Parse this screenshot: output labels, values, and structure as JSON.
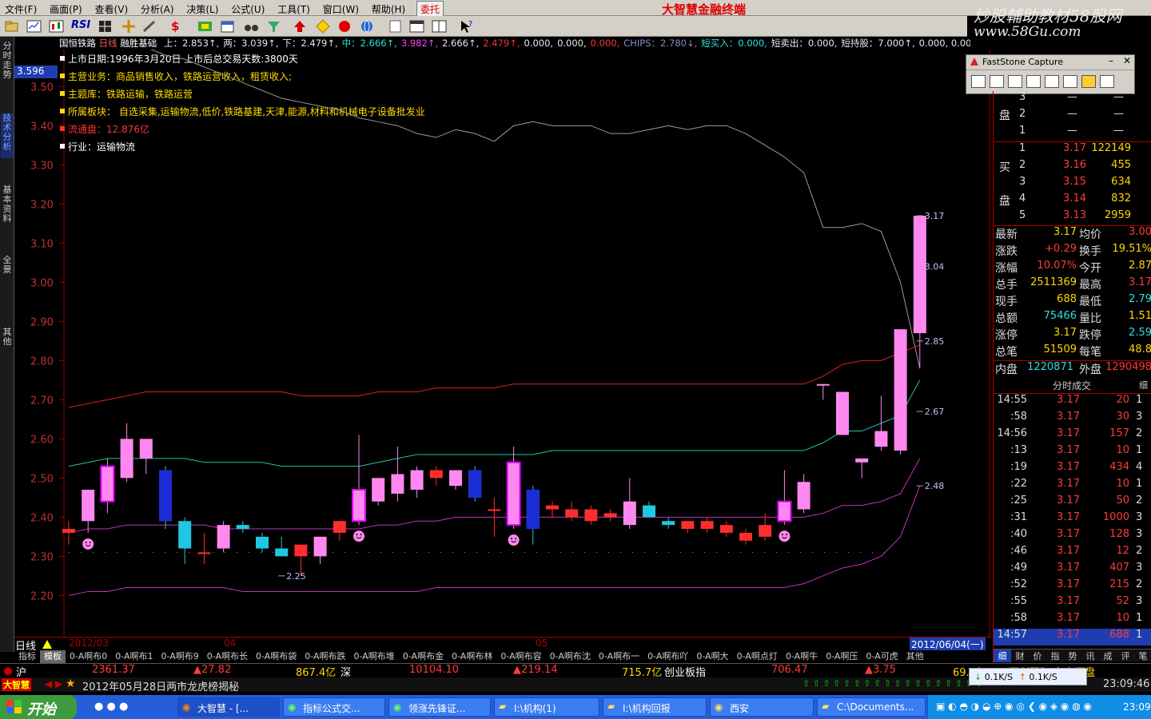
{
  "menu": [
    "文件(F)",
    "画面(P)",
    "查看(V)",
    "分析(A)",
    "决策(L)",
    "公式(U)",
    "工具(T)",
    "窗口(W)",
    "帮助(H)"
  ],
  "entrust_label": "委托",
  "app_title": "大智慧金融终端",
  "watermark": {
    "line1": "炒股輔助教材58股网",
    "line2": "www.58Gu.com"
  },
  "toolbar_rsi": "RSI",
  "left_tabs": [
    "分时走势",
    "技术分析",
    "基本资料",
    "全景",
    "其他"
  ],
  "stock_header": {
    "name": "国恒铁路",
    "period": "日线",
    "indicator": "融胜基础",
    "items": [
      {
        "t": "上：2.853↑,",
        "c": "#e8e8e8"
      },
      {
        "t": "两：3.039↑,",
        "c": "#e8e8e8"
      },
      {
        "t": "下：2.479↑,",
        "c": "#e8e8e8"
      },
      {
        "t": "中：2.666↑,",
        "c": "#2ee0e0"
      },
      {
        "t": "3.982↑,",
        "c": "#ff44ff"
      },
      {
        "t": "2.666↑,",
        "c": "#e8e8e8"
      },
      {
        "t": "2.479↑,",
        "c": "#ff3333"
      },
      {
        "t": "0.000,",
        "c": "#e8e8e8"
      },
      {
        "t": "0.000,",
        "c": "#e8e8e8"
      },
      {
        "t": "0.000,",
        "c": "#ff3333"
      },
      {
        "t": "CHIPS：2.780↓,",
        "c": "#8888cc"
      },
      {
        "t": "短买入：0.000,",
        "c": "#2ee0e0"
      },
      {
        "t": "短卖出：0.000,",
        "c": "#e8e8e8"
      },
      {
        "t": "短持股：7.000↑,",
        "c": "#e8e8e8"
      },
      {
        "t": "0.000, 0.000, 0.000,",
        "c": "#e8e8e8"
      }
    ]
  },
  "f10": [
    {
      "text": "上市日期:1996年3月20日  上市后总交易天数:3800天",
      "color": "#ffffff"
    },
    {
      "text": "主营业务：商品销售收入，铁路运营收入，租赁收入;",
      "color": "#ffdd00"
    },
    {
      "text": "主题库：铁路运输，铁路运营",
      "color": "#ffdd00"
    },
    {
      "text": "所属板块：  自选采集,运输物流,低价,铁路基建,天津,能源,材料和机械电子设备批发业",
      "color": "#ffdd00"
    },
    {
      "text": "流通盘：12.876亿",
      "color": "#ff3333"
    },
    {
      "text": "行业：运输物流",
      "color": "#ffffff"
    }
  ],
  "current_price_tag": "3.596",
  "chart_data": {
    "type": "candlestick",
    "ylim": [
      2.18,
      3.62
    ],
    "yticks": [
      "3.50",
      "3.40",
      "3.30",
      "3.20",
      "3.10",
      "3.00",
      "2.90",
      "2.80",
      "2.70",
      "2.60",
      "2.50",
      "2.40",
      "2.30",
      "2.20"
    ],
    "x_labels": [
      "2012/03",
      "04",
      "05"
    ],
    "end_date": "2012/06/04(一)",
    "period_label": "日线",
    "candles": [
      {
        "o": 2.36,
        "h": 2.39,
        "l": 2.33,
        "c": 2.37
      },
      {
        "o": 2.39,
        "h": 2.47,
        "l": 2.36,
        "c": 2.47
      },
      {
        "o": 2.44,
        "h": 2.55,
        "l": 2.41,
        "c": 2.53
      },
      {
        "o": 2.5,
        "h": 2.64,
        "l": 2.49,
        "c": 2.6
      },
      {
        "o": 2.55,
        "h": 2.6,
        "l": 2.51,
        "c": 2.6
      },
      {
        "o": 2.52,
        "h": 2.53,
        "l": 2.37,
        "c": 2.39
      },
      {
        "o": 2.39,
        "h": 2.4,
        "l": 2.28,
        "c": 2.32
      },
      {
        "o": 2.31,
        "h": 2.36,
        "l": 2.28,
        "c": 2.31
      },
      {
        "o": 2.32,
        "h": 2.39,
        "l": 2.31,
        "c": 2.38
      },
      {
        "o": 2.38,
        "h": 2.39,
        "l": 2.36,
        "c": 2.37
      },
      {
        "o": 2.35,
        "h": 2.36,
        "l": 2.31,
        "c": 2.32
      },
      {
        "o": 2.32,
        "h": 2.35,
        "l": 2.3,
        "c": 2.3
      },
      {
        "o": 2.3,
        "h": 2.33,
        "l": 2.25,
        "c": 2.33
      },
      {
        "o": 2.3,
        "h": 2.35,
        "l": 2.28,
        "c": 2.35
      },
      {
        "o": 2.36,
        "h": 2.39,
        "l": 2.34,
        "c": 2.39
      },
      {
        "o": 2.39,
        "h": 2.61,
        "l": 2.38,
        "c": 2.47
      },
      {
        "o": 2.44,
        "h": 2.5,
        "l": 2.43,
        "c": 2.5
      },
      {
        "o": 2.46,
        "h": 2.58,
        "l": 2.44,
        "c": 2.51
      },
      {
        "o": 2.47,
        "h": 2.53,
        "l": 2.45,
        "c": 2.52
      },
      {
        "o": 2.5,
        "h": 2.53,
        "l": 2.48,
        "c": 2.52
      },
      {
        "o": 2.48,
        "h": 2.52,
        "l": 2.47,
        "c": 2.52
      },
      {
        "o": 2.52,
        "h": 2.53,
        "l": 2.44,
        "c": 2.45
      },
      {
        "o": 2.42,
        "h": 2.45,
        "l": 2.35,
        "c": 2.42
      },
      {
        "o": 2.38,
        "h": 2.58,
        "l": 2.37,
        "c": 2.54
      },
      {
        "o": 2.47,
        "h": 2.48,
        "l": 2.33,
        "c": 2.37
      },
      {
        "o": 2.42,
        "h": 2.44,
        "l": 2.4,
        "c": 2.43
      },
      {
        "o": 2.4,
        "h": 2.44,
        "l": 2.39,
        "c": 2.42
      },
      {
        "o": 2.39,
        "h": 2.43,
        "l": 2.38,
        "c": 2.42
      },
      {
        "o": 2.4,
        "h": 2.42,
        "l": 2.39,
        "c": 2.41
      },
      {
        "o": 2.38,
        "h": 2.5,
        "l": 2.37,
        "c": 2.44
      },
      {
        "o": 2.43,
        "h": 2.44,
        "l": 2.4,
        "c": 2.4
      },
      {
        "o": 2.39,
        "h": 2.4,
        "l": 2.37,
        "c": 2.38
      },
      {
        "o": 2.37,
        "h": 2.39,
        "l": 2.36,
        "c": 2.39
      },
      {
        "o": 2.37,
        "h": 2.4,
        "l": 2.36,
        "c": 2.39
      },
      {
        "o": 2.36,
        "h": 2.39,
        "l": 2.35,
        "c": 2.38
      },
      {
        "o": 2.34,
        "h": 2.37,
        "l": 2.33,
        "c": 2.36
      },
      {
        "o": 2.35,
        "h": 2.41,
        "l": 2.34,
        "c": 2.38
      },
      {
        "o": 2.39,
        "h": 2.52,
        "l": 2.38,
        "c": 2.44
      },
      {
        "o": 2.42,
        "h": 2.51,
        "l": 2.41,
        "c": 2.49
      },
      {
        "o": 2.74,
        "h": 2.74,
        "l": 2.7,
        "c": 2.74
      },
      {
        "o": 2.61,
        "h": 2.72,
        "l": 2.61,
        "c": 2.72
      },
      {
        "o": 2.54,
        "h": 2.55,
        "l": 2.5,
        "c": 2.55
      },
      {
        "o": 2.58,
        "h": 2.71,
        "l": 2.57,
        "c": 2.62
      },
      {
        "o": 2.57,
        "h": 2.88,
        "l": 2.56,
        "c": 2.88
      },
      {
        "o": 2.87,
        "h": 3.17,
        "l": 2.78,
        "c": 3.17
      }
    ],
    "upper_mid": [
      2.68,
      2.69,
      2.7,
      2.71,
      2.72,
      2.72,
      2.72,
      2.72,
      2.72,
      2.72,
      2.72,
      2.72,
      2.71,
      2.71,
      2.71,
      2.71,
      2.72,
      2.72,
      2.72,
      2.73,
      2.73,
      2.73,
      2.73,
      2.74,
      2.74,
      2.74,
      2.74,
      2.74,
      2.74,
      2.74,
      2.74,
      2.74,
      2.74,
      2.74,
      2.74,
      2.74,
      2.74,
      2.74,
      2.74,
      2.76,
      2.79,
      2.8,
      2.8,
      2.82,
      2.84
    ],
    "mid_cyan": [
      2.53,
      2.54,
      2.55,
      2.55,
      2.55,
      2.55,
      2.55,
      2.54,
      2.54,
      2.54,
      2.54,
      2.53,
      2.53,
      2.53,
      2.53,
      2.53,
      2.54,
      2.55,
      2.56,
      2.56,
      2.56,
      2.56,
      2.56,
      2.56,
      2.56,
      2.57,
      2.57,
      2.57,
      2.57,
      2.57,
      2.57,
      2.57,
      2.57,
      2.57,
      2.57,
      2.57,
      2.57,
      2.57,
      2.57,
      2.59,
      2.62,
      2.62,
      2.64,
      2.66,
      2.75
    ],
    "lower_mid": [
      2.36,
      2.37,
      2.37,
      2.38,
      2.38,
      2.38,
      2.38,
      2.38,
      2.37,
      2.37,
      2.37,
      2.37,
      2.37,
      2.37,
      2.37,
      2.37,
      2.38,
      2.38,
      2.39,
      2.39,
      2.4,
      2.4,
      2.4,
      2.4,
      2.4,
      2.4,
      2.4,
      2.4,
      2.4,
      2.4,
      2.4,
      2.4,
      2.4,
      2.4,
      2.4,
      2.4,
      2.4,
      2.4,
      2.4,
      2.41,
      2.43,
      2.43,
      2.44,
      2.46,
      2.55
    ],
    "lower": [
      2.2,
      2.21,
      2.21,
      2.22,
      2.22,
      2.22,
      2.22,
      2.22,
      2.22,
      2.21,
      2.21,
      2.21,
      2.21,
      2.21,
      2.21,
      2.21,
      2.21,
      2.21,
      2.21,
      2.22,
      2.22,
      2.22,
      2.22,
      2.22,
      2.22,
      2.22,
      2.22,
      2.22,
      2.22,
      2.22,
      2.22,
      2.22,
      2.22,
      2.22,
      2.22,
      2.22,
      2.22,
      2.22,
      2.23,
      2.25,
      2.27,
      2.28,
      2.3,
      2.35,
      2.48
    ],
    "gray_line": [
      3.7,
      3.68,
      3.65,
      3.62,
      3.6,
      3.58,
      3.57,
      3.55,
      3.53,
      3.51,
      3.49,
      3.47,
      3.46,
      3.45,
      3.44,
      3.42,
      3.41,
      3.4,
      3.38,
      3.37,
      3.39,
      3.38,
      3.36,
      3.4,
      3.41,
      3.4,
      3.4,
      3.4,
      3.38,
      3.38,
      3.39,
      3.4,
      3.39,
      3.4,
      3.4,
      3.38,
      3.35,
      3.32,
      3.28,
      3.14,
      3.14,
      3.15,
      3.13,
      3.0,
      2.78
    ],
    "labels": [
      {
        "i": 44,
        "y": 3.17,
        "text": "3.17"
      },
      {
        "i": 44,
        "y": 3.04,
        "text": "3.04"
      },
      {
        "i": 44,
        "y": 2.85,
        "text": "2.85"
      },
      {
        "i": 44,
        "y": 2.67,
        "text": "2.67"
      },
      {
        "i": 44,
        "y": 2.48,
        "text": "2.48"
      },
      {
        "i": 11,
        "y": 2.25,
        "text": "2.25"
      }
    ],
    "smileys": [
      1,
      15,
      23,
      37
    ],
    "markers": [
      5,
      23,
      21,
      24
    ]
  },
  "indicator_tabs": [
    "指标",
    "模板",
    "0-A啊布0",
    "0-A啊布1",
    "0-A啊布9",
    "0-A啊布长",
    "0-A啊布袋",
    "0-A啊布跌",
    "0-A啊布堆",
    "0-A啊布金",
    "0-A啊布林",
    "0-A啊布容",
    "0-A啊布沈",
    "0-A啊布一",
    "0-A啊布吖",
    "0-A啊大",
    "0-A啊点灯",
    "0-A啊牛",
    "0-A啊压",
    "0-A可虎",
    "其他"
  ],
  "order_book": {
    "sell_label": "盘",
    "buy_label_1": "买",
    "buy_label_2": "盘",
    "sells": [
      {
        "n": "3",
        "p": "—",
        "v": "—"
      },
      {
        "n": "2",
        "p": "—",
        "v": "—"
      },
      {
        "n": "1",
        "p": "—",
        "v": "—"
      }
    ],
    "buys": [
      {
        "n": "1",
        "p": "3.17",
        "v": "122149"
      },
      {
        "n": "2",
        "p": "3.16",
        "v": "455"
      },
      {
        "n": "3",
        "p": "3.15",
        "v": "634"
      },
      {
        "n": "4",
        "p": "3.14",
        "v": "832"
      },
      {
        "n": "5",
        "p": "3.13",
        "v": "2959"
      }
    ]
  },
  "quote": [
    {
      "l1": "最新",
      "v1": "3.17",
      "l2": "均价",
      "v2": "3.00"
    },
    {
      "l1": "涨跌",
      "v1": "+0.29",
      "l2": "换手",
      "v2": "19.51%"
    },
    {
      "l1": "涨幅",
      "v1": "10.07%",
      "l2": "今开",
      "v2": "2.87"
    },
    {
      "l1": "总手",
      "v1": "2511369",
      "l2": "最高",
      "v2": "3.17"
    },
    {
      "l1": "现手",
      "v1": "688",
      "l2": "最低",
      "v2": "2.79"
    },
    {
      "l1": "总额",
      "v1": "75466",
      "l2": "量比",
      "v2": "1.51"
    },
    {
      "l1": "涨停",
      "v1": "3.17",
      "l2": "跌停",
      "v2": "2.59"
    },
    {
      "l1": "总笔",
      "v1": "51509",
      "l2": "每笔",
      "v2": "48.8"
    }
  ],
  "inner_outer": {
    "inner_label": "内盘",
    "inner": "1220871",
    "outer_label": "外盘",
    "outer": "1290498"
  },
  "ticks_header": {
    "title": "分时成交",
    "right": "细"
  },
  "ticks": [
    {
      "t": "14:55",
      "p": "3.17",
      "v": "20",
      "n": "1"
    },
    {
      "t": ":58",
      "p": "3.17",
      "v": "30",
      "n": "3"
    },
    {
      "t": "14:56",
      "p": "3.17",
      "v": "157",
      "n": "2"
    },
    {
      "t": ":13",
      "p": "3.17",
      "v": "10",
      "n": "1"
    },
    {
      "t": ":19",
      "p": "3.17",
      "v": "434",
      "n": "4"
    },
    {
      "t": ":22",
      "p": "3.17",
      "v": "10",
      "n": "1"
    },
    {
      "t": ":25",
      "p": "3.17",
      "v": "50",
      "n": "2"
    },
    {
      "t": ":31",
      "p": "3.17",
      "v": "1000",
      "n": "3"
    },
    {
      "t": ":40",
      "p": "3.17",
      "v": "128",
      "n": "3"
    },
    {
      "t": ":46",
      "p": "3.17",
      "v": "12",
      "n": "2"
    },
    {
      "t": ":49",
      "p": "3.17",
      "v": "407",
      "n": "3"
    },
    {
      "t": ":52",
      "p": "3.17",
      "v": "215",
      "n": "2"
    },
    {
      "t": ":55",
      "p": "3.17",
      "v": "52",
      "n": "3"
    },
    {
      "t": ":58",
      "p": "3.17",
      "v": "10",
      "n": "1"
    },
    {
      "t": "14:57",
      "p": "3.17",
      "v": "688",
      "n": "1"
    }
  ],
  "right_tabs": [
    "细",
    "财",
    "价",
    "指",
    "势",
    "讯",
    "成",
    "评",
    "笔"
  ],
  "fastcapture_title": "FastStone Capture",
  "index_bar": {
    "sh_label": "沪",
    "sh_val": "2361.37",
    "sh_chg": "▲27.82",
    "sh_amt": "867.4亿",
    "sz_label": "深",
    "sz_val": "10104.10",
    "sz_chg": "▲219.14",
    "sz_amt": "715.7亿",
    "cy_label": "创业板指",
    "cy_val": "706.47",
    "cy_chg": "▲3.75",
    "cy_amt": "69.6亿",
    "news_right": "开创国际 东方买盘"
  },
  "news": {
    "logo": "大智慧",
    "text": "2012年05月28日两市龙虎榜揭秘",
    "time": "23:09:46",
    "speed1": "0.1K/S",
    "speed2": "0.1K/S"
  },
  "taskbar": {
    "start": "开始",
    "tasks": [
      "大智慧 - [...",
      "指标公式交...",
      "领涨先锋证...",
      "I:\\机构(1)",
      "I:\\机构回报",
      "西安",
      "C:\\Documents..."
    ],
    "clock": "23:09"
  },
  "colors": {
    "up": "#ff2d2d",
    "down": "#21c7e0",
    "channel_upper": "#e02020",
    "channel_mid": "#22c4a8",
    "channel_low": "#c030c0",
    "gray": "#9a9a9a",
    "axis": "#a00000"
  }
}
